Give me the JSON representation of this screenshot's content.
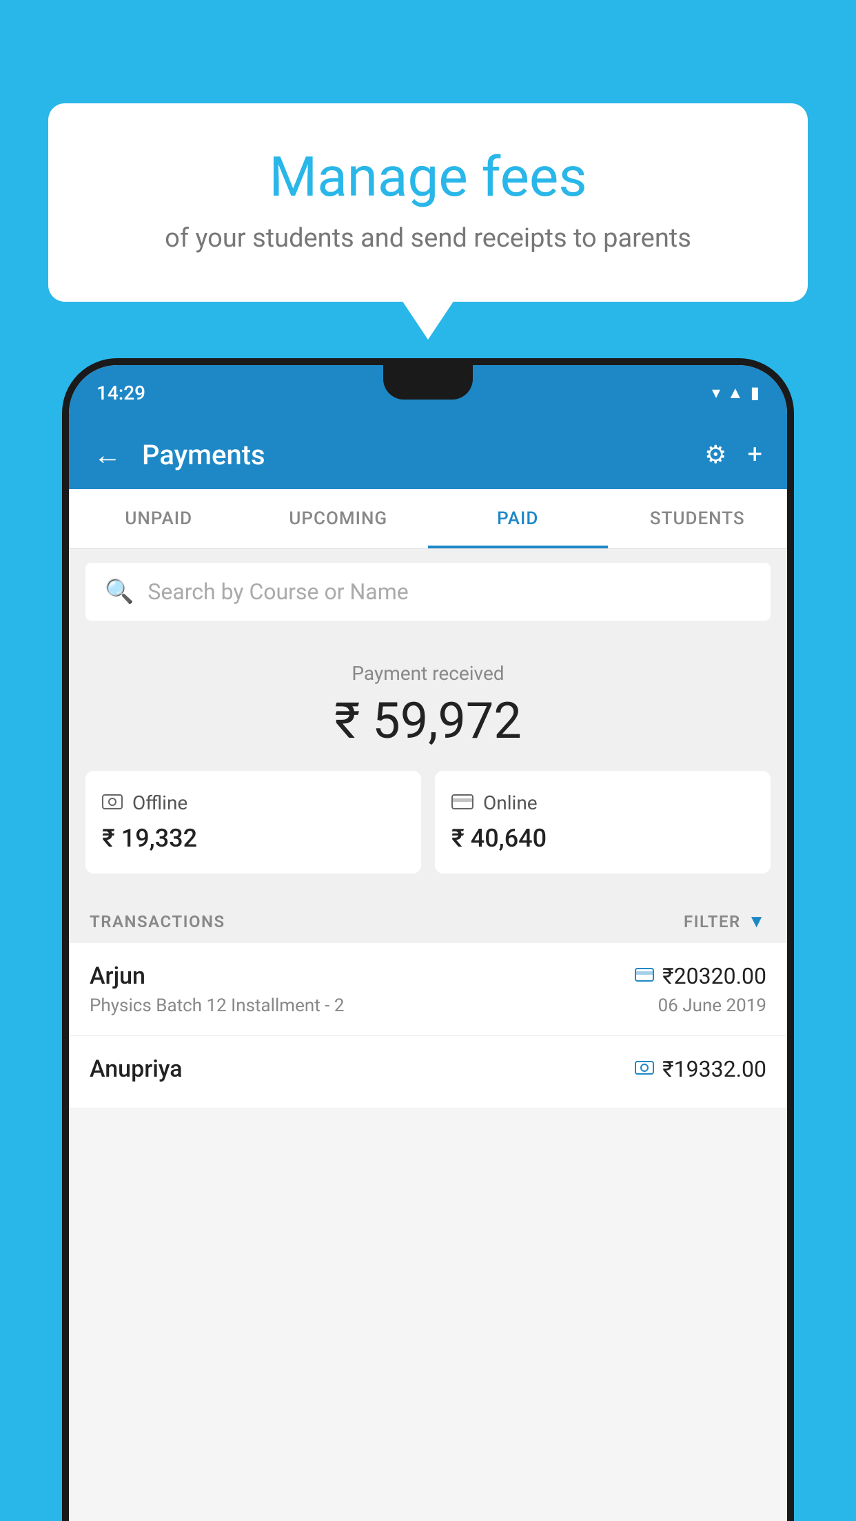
{
  "background": {
    "color": "#29b6e8"
  },
  "speech_bubble": {
    "title": "Manage fees",
    "subtitle": "of your students and send receipts to parents"
  },
  "status_bar": {
    "time": "14:29",
    "icons": [
      "wifi",
      "signal",
      "battery"
    ]
  },
  "app_bar": {
    "back_label": "←",
    "title": "Payments",
    "settings_icon": "⚙",
    "add_icon": "+"
  },
  "tabs": [
    {
      "label": "UNPAID",
      "active": false
    },
    {
      "label": "UPCOMING",
      "active": false
    },
    {
      "label": "PAID",
      "active": true
    },
    {
      "label": "STUDENTS",
      "active": false
    }
  ],
  "search": {
    "placeholder": "Search by Course or Name"
  },
  "payment_summary": {
    "label": "Payment received",
    "amount": "₹ 59,972",
    "offline": {
      "type": "Offline",
      "amount": "₹ 19,332"
    },
    "online": {
      "type": "Online",
      "amount": "₹ 40,640"
    }
  },
  "transactions_section": {
    "label": "TRANSACTIONS",
    "filter_label": "FILTER"
  },
  "transactions": [
    {
      "name": "Arjun",
      "description": "Physics Batch 12 Installment - 2",
      "amount": "₹20320.00",
      "date": "06 June 2019",
      "mode": "card"
    },
    {
      "name": "Anupriya",
      "description": "",
      "amount": "₹19332.00",
      "date": "",
      "mode": "cash"
    }
  ]
}
